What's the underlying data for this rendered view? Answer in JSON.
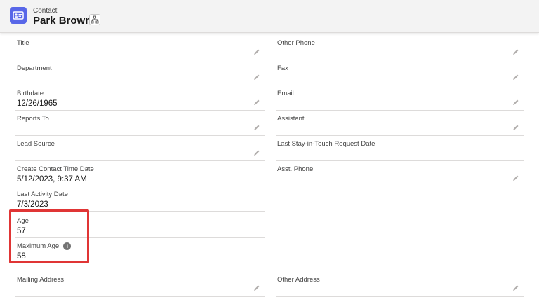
{
  "header": {
    "object_label": "Contact",
    "record_name": "Park Brown",
    "contact_icon": "contact-card-icon",
    "hierarchy_icon": "hierarchy-icon"
  },
  "left_fields": [
    {
      "label": "Title",
      "value": ""
    },
    {
      "label": "Department",
      "value": ""
    },
    {
      "label": "Birthdate",
      "value": "12/26/1965"
    },
    {
      "label": "Reports To",
      "value": ""
    },
    {
      "label": "Lead Source",
      "value": ""
    },
    {
      "label": "Create Contact Time Date",
      "value": "5/12/2023, 9:37 AM"
    },
    {
      "label": "Last Activity Date",
      "value": "7/3/2023"
    },
    {
      "label": "Age",
      "value": "57"
    },
    {
      "label": "Maximum Age",
      "value": "58"
    },
    {
      "label": "Mailing Address",
      "value": ""
    }
  ],
  "right_fields": [
    {
      "label": "Other Phone",
      "value": ""
    },
    {
      "label": "Fax",
      "value": ""
    },
    {
      "label": "Email",
      "value": ""
    },
    {
      "label": "Assistant",
      "value": ""
    },
    {
      "label": "Last Stay-in-Touch Request Date",
      "value": ""
    },
    {
      "label": "Asst. Phone",
      "value": ""
    },
    {
      "label": "Other Address",
      "value": ""
    }
  ],
  "colors": {
    "brand_icon": "#5867e8",
    "highlight": "#e03535"
  }
}
